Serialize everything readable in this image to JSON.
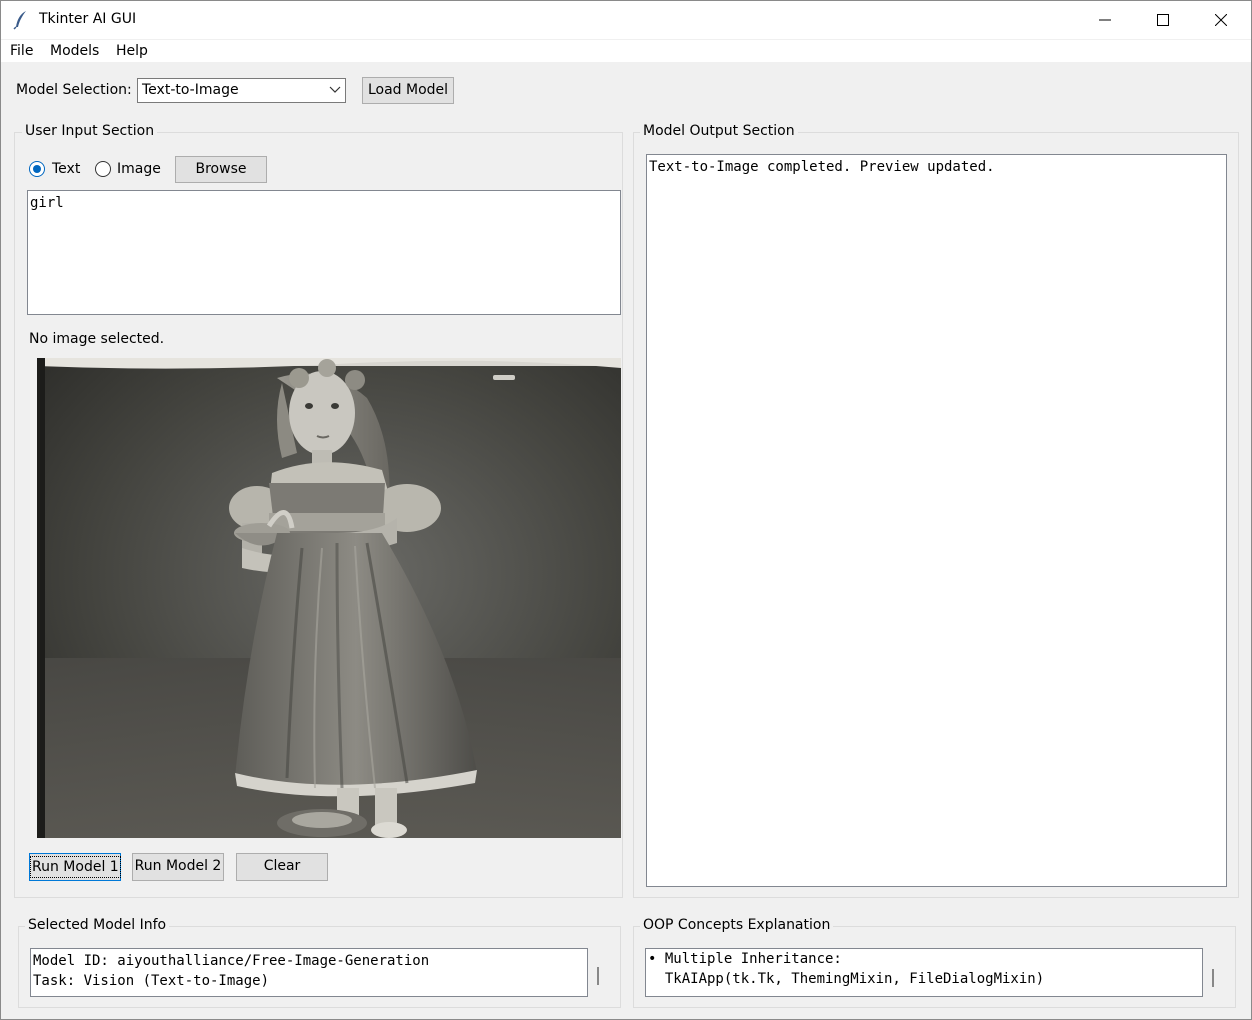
{
  "window": {
    "title": "Tkinter AI GUI"
  },
  "menu": [
    "File",
    "Models",
    "Help"
  ],
  "toolbar": {
    "model_selection_label": "Model Selection:",
    "model_selected": "Text-to-Image",
    "load_button": "Load Model"
  },
  "input_section": {
    "title": "User Input Section",
    "radio_text": "Text",
    "radio_image": "Image",
    "input_mode": "Text",
    "browse_button": "Browse",
    "input_text": "girl",
    "image_status": "No image selected.",
    "preview_icon": "generated-image-girl-in-dress",
    "run1_button": "Run Model 1",
    "run2_button": "Run Model 2",
    "clear_button": "Clear"
  },
  "output_section": {
    "title": "Model Output Section",
    "output_text": "Text-to-Image completed. Preview updated."
  },
  "model_info": {
    "title": "Selected Model Info",
    "text": "Model ID: aiyouthalliance/Free-Image-Generation\nTask: Vision (Text-to-Image)"
  },
  "oop": {
    "title": "OOP Concepts Explanation",
    "text": "• Multiple Inheritance:\n  TkAIApp(tk.Tk, ThemingMixin, FileDialogMixin)"
  }
}
